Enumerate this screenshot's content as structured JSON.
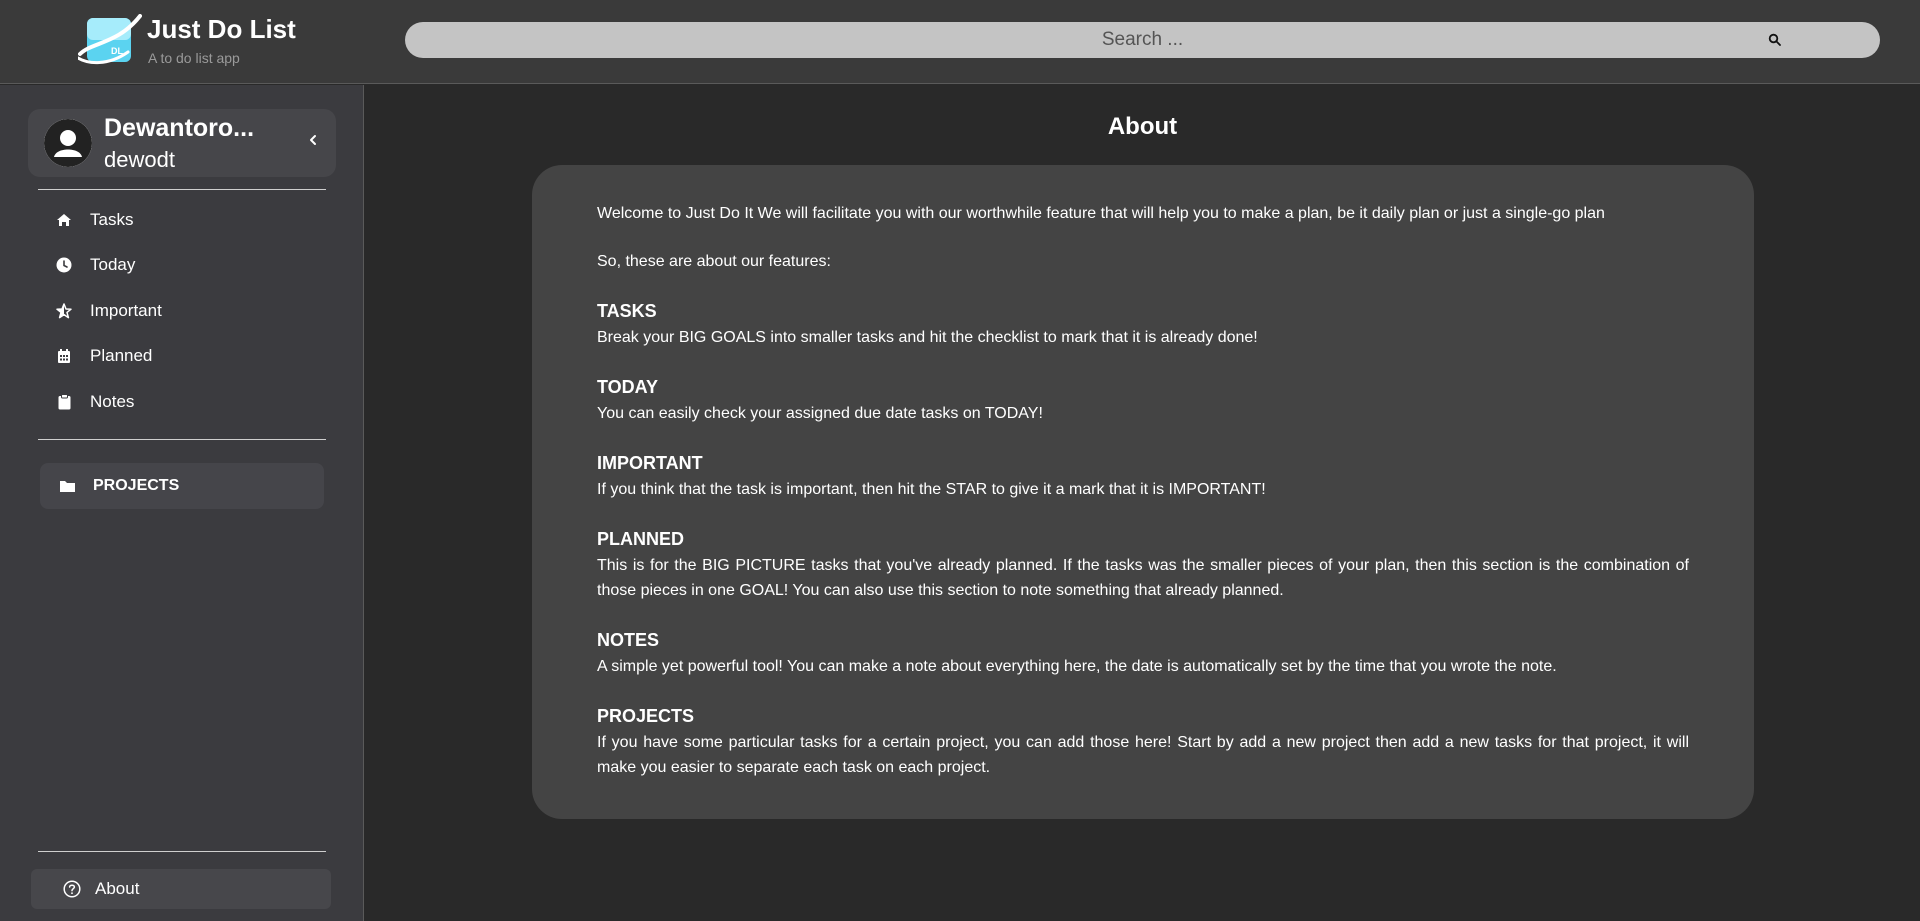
{
  "header": {
    "app_title": "Just Do List",
    "app_subtitle": "A to do list app",
    "logo_text": "DL",
    "search_placeholder": "Search ..."
  },
  "sidebar": {
    "profile": {
      "name": "Dewantoro...",
      "username": "dewodt"
    },
    "nav_items": [
      {
        "label": "Tasks",
        "icon": "home-icon"
      },
      {
        "label": "Today",
        "icon": "clock-icon"
      },
      {
        "label": "Important",
        "icon": "star-icon"
      },
      {
        "label": "Planned",
        "icon": "calendar-icon"
      },
      {
        "label": "Notes",
        "icon": "clipboard-icon"
      }
    ],
    "projects_label": "PROJECTS",
    "about_label": "About"
  },
  "main": {
    "title": "About",
    "intro": "Welcome to Just Do It We will facilitate you with our worthwhile feature that will help you to make a plan, be it daily plan or just a single-go plan",
    "features_intro": "So, these are about our features:",
    "features": [
      {
        "title": "TASKS",
        "desc": "Break your BIG GOALS into smaller tasks and hit the checklist to mark that it is already done!"
      },
      {
        "title": "TODAY",
        "desc": "You can easily check your assigned due date tasks on TODAY!"
      },
      {
        "title": "IMPORTANT",
        "desc": "If you think that the task is important, then hit the STAR to give it a mark that it is IMPORTANT!"
      },
      {
        "title": "PLANNED",
        "desc": "This is for the BIG PICTURE tasks that you've already planned. If the tasks was the smaller pieces of your plan, then this section is the combination of those pieces in one GOAL! You can also use this section to note something that already planned."
      },
      {
        "title": "NOTES",
        "desc": "A simple yet powerful tool! You can make a note about everything here, the date is automatically set by the time that you wrote the note."
      },
      {
        "title": "PROJECTS",
        "desc": "If you have some particular tasks for a certain project, you can add those here! Start by add a new project then add a new tasks for that project, it will make you easier to separate each task on each project."
      }
    ]
  },
  "colors": {
    "background": "#292929",
    "header": "#3a3a3a",
    "sidebar": "#3b3b3f",
    "card": "#444444",
    "search": "#c4c4c4",
    "logo_accent": "#5bd3f0"
  }
}
